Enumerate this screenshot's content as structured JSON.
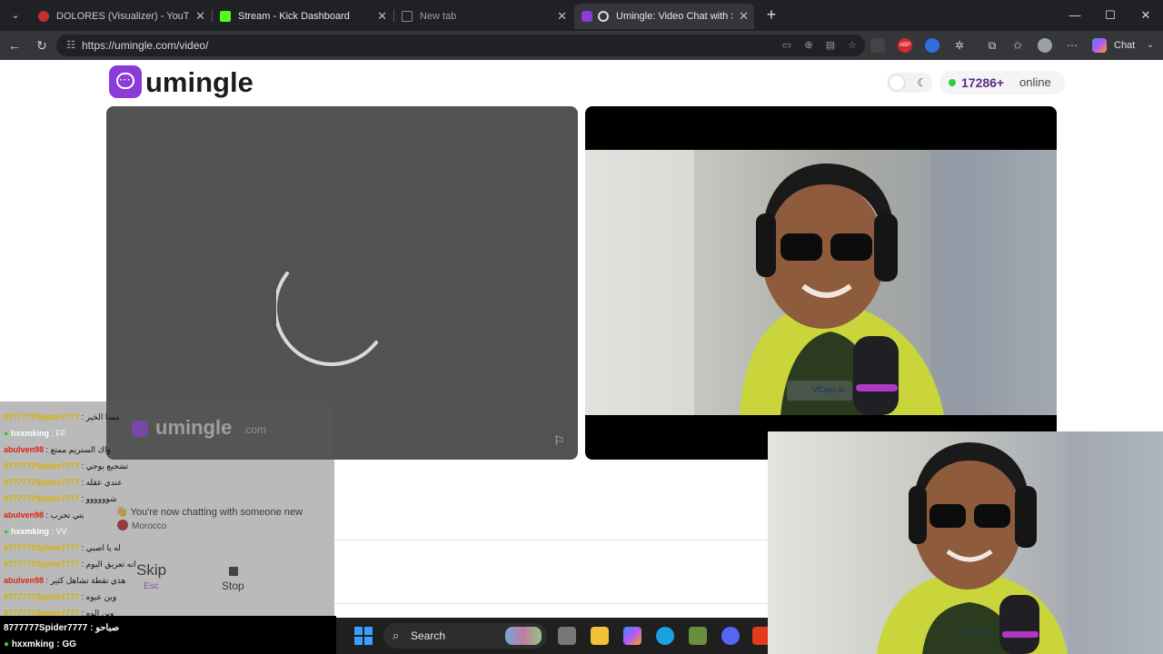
{
  "browser": {
    "tabs": [
      {
        "label": "DOLORES (Visualizer) - YouTube",
        "close": "✕"
      },
      {
        "label": "Stream - Kick Dashboard",
        "close": "✕"
      },
      {
        "label": "New tab",
        "close": "✕"
      },
      {
        "label": "Umingle: Video Chat with Stra",
        "close": "✕"
      }
    ],
    "new_tab": "+",
    "window_controls": {
      "minimize": "—",
      "maximize": "☐",
      "close": "✕"
    },
    "url": "https://umingle.com/video/",
    "chat_label": "Chat",
    "extensions": {
      "abp": "ABP"
    }
  },
  "site": {
    "logo_text": "umingle",
    "online_count": "17286+",
    "online_label": "online",
    "theme_icon": "☾",
    "watermark": "umingle",
    "watermark_suffix": ".com",
    "vcam_label": "VCam.ai",
    "system_message": "You're now chatting with someone new",
    "system_emoji": "👋",
    "country": "Morocco",
    "skip_label": "Skip",
    "skip_key": "Esc",
    "stop_label": "Stop"
  },
  "stream_chat": [
    {
      "user": "8777777Spider7777",
      "msg": ": مسا الخير",
      "color": "#d4b200"
    },
    {
      "user": "hxxmking",
      "msg": ": FF",
      "color": "#ffffff",
      "badge": true
    },
    {
      "user": "abulven98",
      "msg": ": واك الستريم ممتع",
      "color": "#e0201a"
    },
    {
      "user": "8777777Spider7777",
      "msg": ": تشجيع يوجي",
      "color": "#d4b200"
    },
    {
      "user": "8777777Spider7777",
      "msg": ": عندي عقله",
      "color": "#d4b200"
    },
    {
      "user": "8777777Spider7777",
      "msg": ": شوووووو",
      "color": "#d4b200"
    },
    {
      "user": "abulven98",
      "msg": ": بتي تحرب",
      "color": "#e0201a"
    },
    {
      "user": "hxxmking",
      "msg": ": VV",
      "color": "#ffffff",
      "badge": true
    },
    {
      "user": "8777777Spider7777",
      "msg": ": له يا اصبي",
      "color": "#d4b200"
    },
    {
      "user": "8777777Spider7777",
      "msg": ": انه تعريق اليوم",
      "color": "#d4b200"
    },
    {
      "user": "abulven98",
      "msg": ": هذي نقطة تشاهل كثير",
      "color": "#e0201a"
    },
    {
      "user": "8777777Spider7777",
      "msg": ": وين عيوه",
      "color": "#d4b200"
    },
    {
      "user": "8777777Spider7777",
      "msg": ": وين الوه",
      "color": "#d4b200"
    }
  ],
  "stream_chat_bottom": [
    {
      "user": "8777777Spider7777",
      "msg": ": صباحو"
    },
    {
      "user": "hxxmking",
      "msg": ": GG",
      "badge": true
    }
  ],
  "taskbar": {
    "search_label": "Search",
    "search_icon": "⌕"
  }
}
